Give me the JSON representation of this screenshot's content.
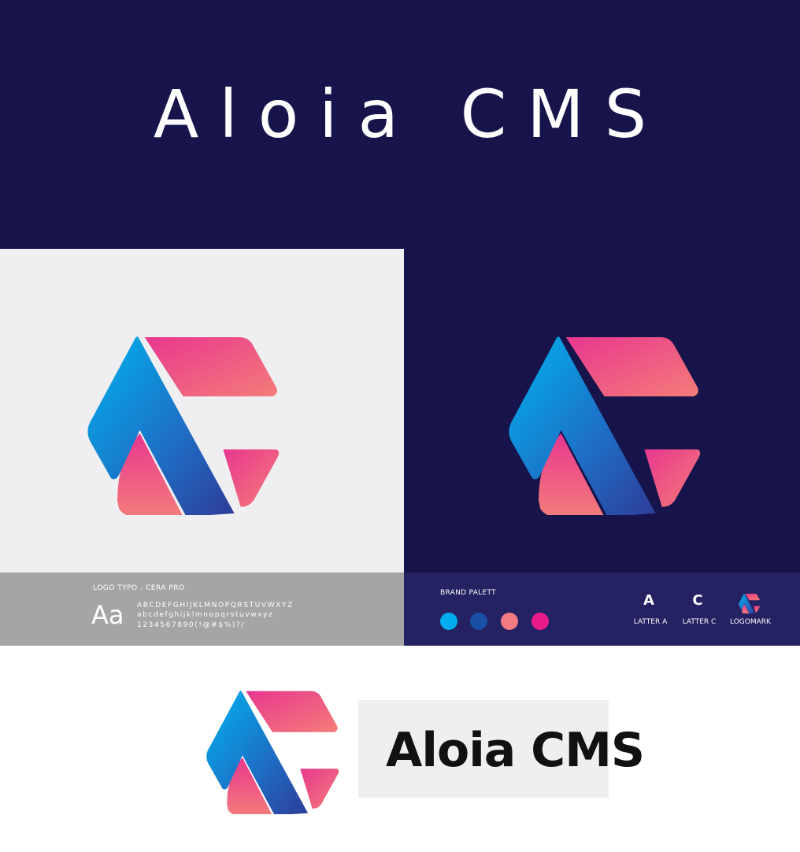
{
  "hero": {
    "title": "Aloia CMS"
  },
  "typography": {
    "label": "LOGO TYPO : CERA PRO",
    "sample": "Aa",
    "uppercase": "ABCDEFGHIJKLMNOPQRSTUVWXYZ",
    "lowercase": "abcdefghijklmnopqrstuvwxyz",
    "numbers": "1234567890(!@#$%)?/"
  },
  "palette": {
    "label": "BRAND PALETT",
    "colors": [
      "#00aeef",
      "#1a4fa8",
      "#f47a82",
      "#ec1b8c"
    ]
  },
  "marks": [
    {
      "glyph": "A",
      "caption": "LATTER A"
    },
    {
      "glyph": "C",
      "caption": "LATTER C"
    },
    {
      "glyph": "",
      "caption": "LOGOMARK"
    }
  ],
  "lockup": {
    "wordmark": "Aloia CMS"
  },
  "icons": [
    "logo-mark-icon"
  ],
  "brand_colors": {
    "navy": "#16144a",
    "light": "#efeff1",
    "gray": "#a5a5a5",
    "strip": "#242263"
  }
}
